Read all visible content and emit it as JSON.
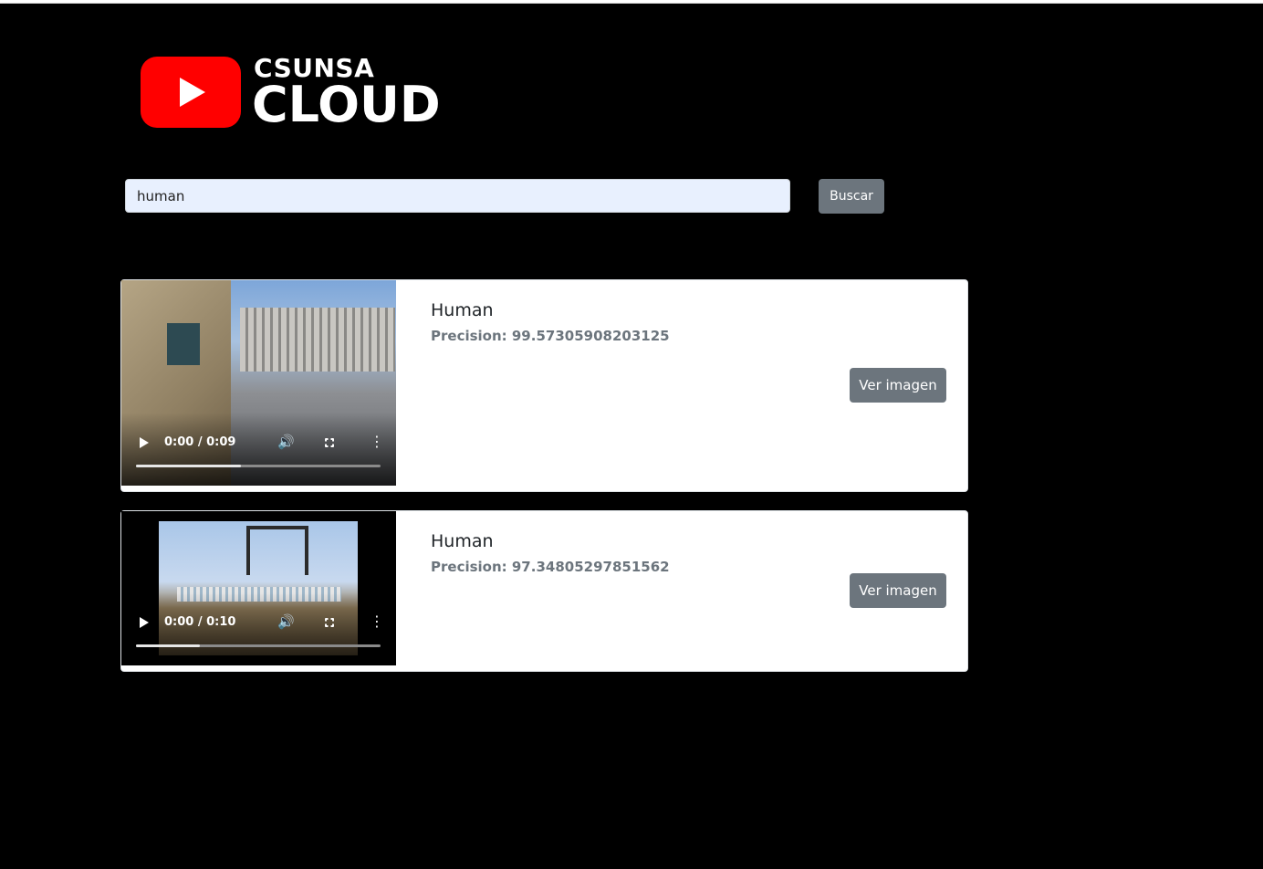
{
  "logo": {
    "small_text": "CSUNSA",
    "big_text": "CLOUD",
    "brand_color": "#ff0000",
    "icon": "play-icon"
  },
  "search": {
    "value": "human",
    "button_label": "Buscar"
  },
  "results": [
    {
      "title": "Human",
      "precision": "Precision: 99.57305908203125",
      "video_time": "0:00 / 0:09",
      "progress": 0.43,
      "button_label": "Ver imagen"
    },
    {
      "title": "Human",
      "precision": "Precision: 97.34805297851562",
      "video_time": "0:00 / 0:10",
      "progress": 0.26,
      "button_label": "Ver imagen"
    }
  ],
  "colors": {
    "background": "#000000",
    "button": "#6c757d",
    "input_bg": "#e8f0fe"
  }
}
